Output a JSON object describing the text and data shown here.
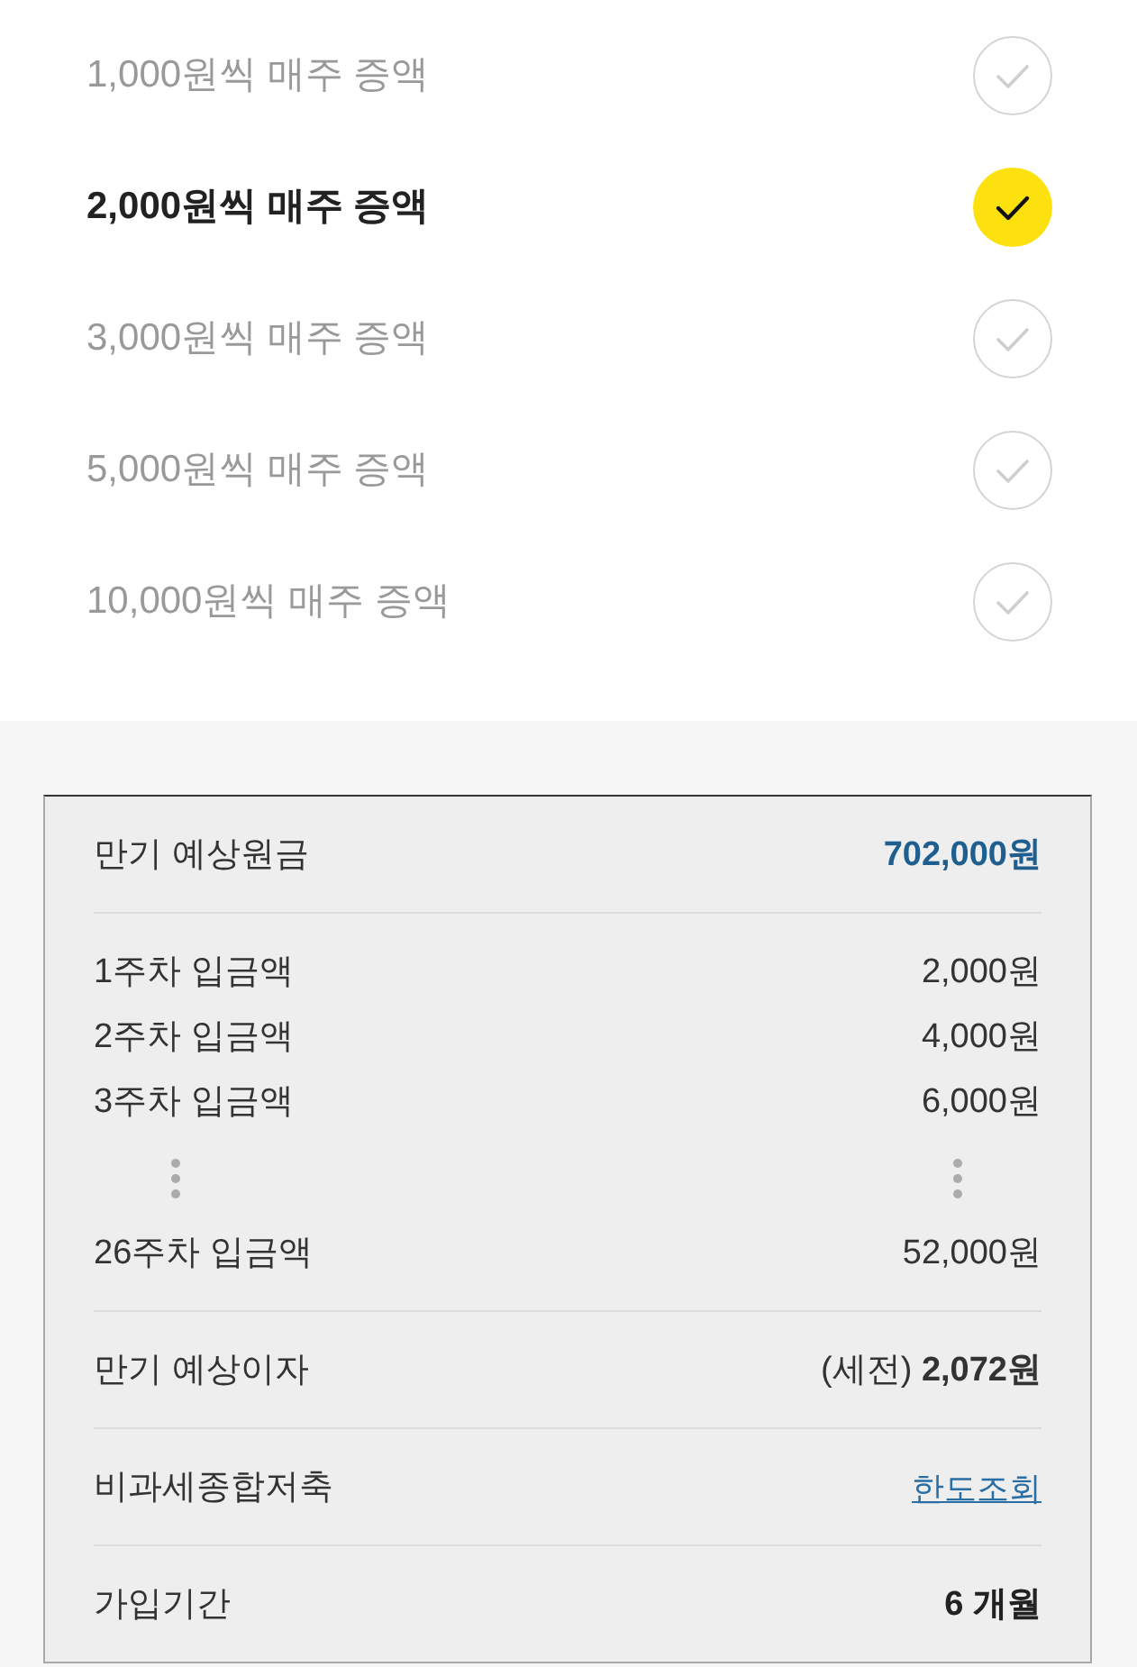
{
  "options": [
    {
      "label": "1,000원씩 매주 증액",
      "selected": false
    },
    {
      "label": "2,000원씩 매주 증액",
      "selected": true
    },
    {
      "label": "3,000원씩 매주 증액",
      "selected": false
    },
    {
      "label": "5,000원씩 매주 증액",
      "selected": false
    },
    {
      "label": "10,000원씩 매주 증액",
      "selected": false
    }
  ],
  "summary": {
    "sections": [
      {
        "rows": [
          {
            "kind": "total",
            "label": "만기 예상원금",
            "value": "702,000원"
          }
        ]
      },
      {
        "rows": [
          {
            "kind": "amount",
            "label": "1주차 입금액",
            "value": "2,000원"
          },
          {
            "kind": "amount",
            "label": "2주차 입금액",
            "value": "4,000원"
          },
          {
            "kind": "amount",
            "label": "3주차 입금액",
            "value": "6,000원"
          },
          {
            "kind": "gap"
          },
          {
            "kind": "amount",
            "label": "26주차 입금액",
            "value": "52,000원"
          }
        ]
      },
      {
        "rows": [
          {
            "kind": "amount",
            "label": "만기 예상이자",
            "value": "(세전) **2,072원**"
          }
        ]
      },
      {
        "rows": [
          {
            "kind": "link",
            "label": "비과세종합저축",
            "value": "한도조회"
          }
        ]
      },
      {
        "rows": [
          {
            "kind": "emphasis",
            "label": "가입기간",
            "value": "6 개월"
          }
        ]
      }
    ]
  }
}
